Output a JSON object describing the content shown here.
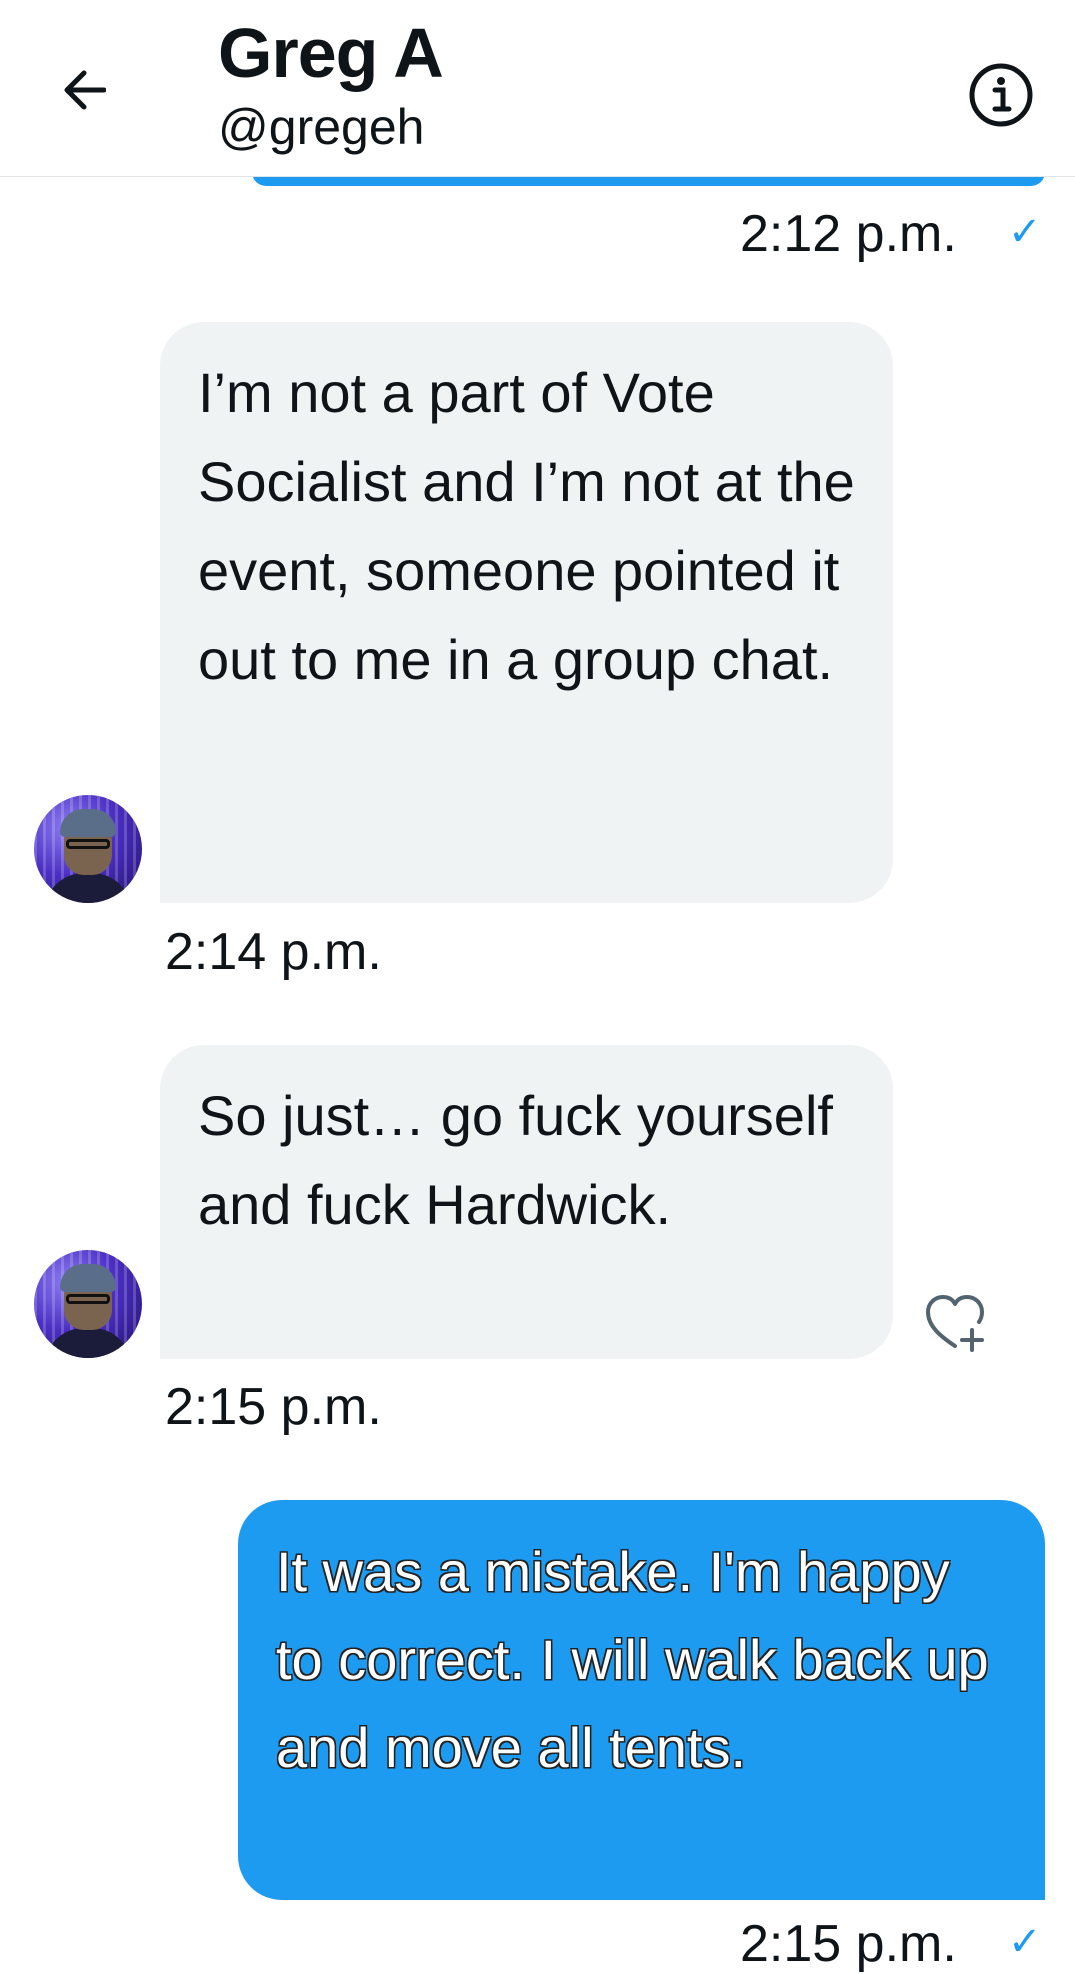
{
  "header": {
    "back_icon": "arrow-left-icon",
    "name": "Greg A",
    "handle": "@gregeh",
    "info_icon": "info-circle-icon"
  },
  "messages": [
    {
      "direction": "outgoing",
      "time": "2:12 p.m.",
      "status": "✓"
    },
    {
      "direction": "incoming",
      "text": "I’m not a part of Vote Socialist and I’m not at the event, someone pointed it out to me in a group chat.",
      "time": "2:14 p.m."
    },
    {
      "direction": "incoming",
      "text": "So just… go fuck yourself and fuck Hardwick.",
      "time": "2:15 p.m.",
      "reaction_icon": "heart-plus-icon"
    },
    {
      "direction": "outgoing",
      "text": "It was a mistake. I'm happy to correct. I will walk back up and move all tents.",
      "time": "2:15 p.m.",
      "status": "✓"
    }
  ],
  "colors": {
    "accent": "#1d9bf0",
    "incoming_bubble": "#eff3f4",
    "text": "#0f1419"
  }
}
